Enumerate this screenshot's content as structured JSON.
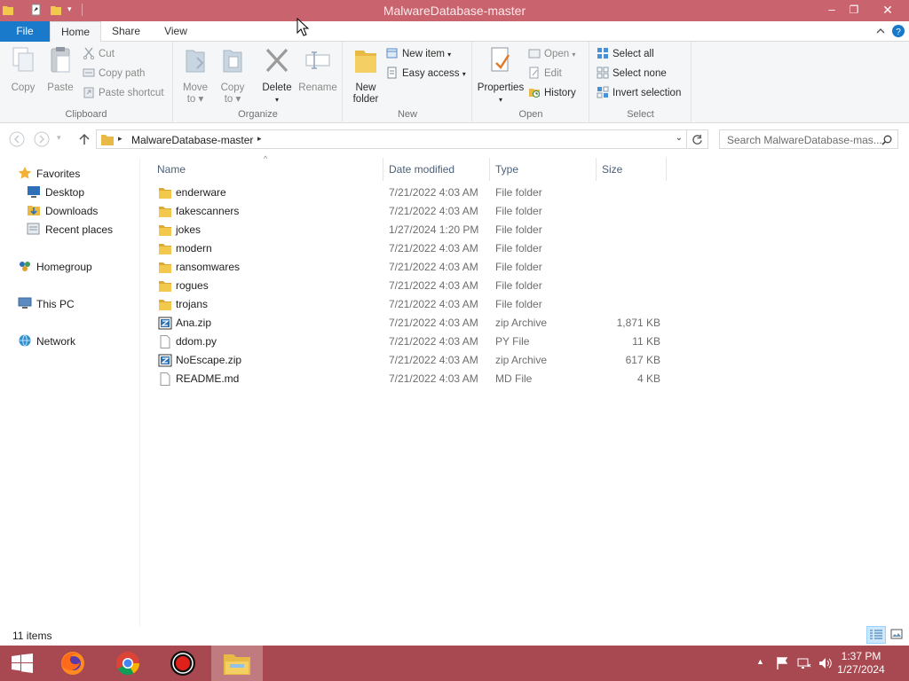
{
  "window": {
    "title": "MalwareDatabase-master"
  },
  "ribbon_tabs": [
    "File",
    "Home",
    "Share",
    "View"
  ],
  "ribbon": {
    "clipboard": {
      "label": "Clipboard",
      "copy": "Copy",
      "paste": "Paste",
      "cut": "Cut",
      "copy_path": "Copy path",
      "paste_shortcut": "Paste shortcut"
    },
    "organize": {
      "label": "Organize",
      "move_to": "Move to",
      "copy_to": "Copy to",
      "delete": "Delete",
      "rename": "Rename"
    },
    "new": {
      "label": "New",
      "new_folder": "New folder",
      "new_item": "New item",
      "easy_access": "Easy access"
    },
    "open": {
      "label": "Open",
      "properties": "Properties",
      "open": "Open",
      "edit": "Edit",
      "history": "History"
    },
    "select": {
      "label": "Select",
      "select_all": "Select all",
      "select_none": "Select none",
      "invert_selection": "Invert selection"
    }
  },
  "address": {
    "path": "MalwareDatabase-master",
    "search_placeholder": "Search MalwareDatabase-mas..."
  },
  "nav_pane": {
    "favorites": "Favorites",
    "desktop": "Desktop",
    "downloads": "Downloads",
    "recent_places": "Recent places",
    "homegroup": "Homegroup",
    "this_pc": "This PC",
    "network": "Network"
  },
  "columns": {
    "name": "Name",
    "date": "Date modified",
    "type": "Type",
    "size": "Size"
  },
  "files": [
    {
      "name": "enderware",
      "date": "7/21/2022 4:03 AM",
      "type": "File folder",
      "size": "",
      "kind": "folder"
    },
    {
      "name": "fakescanners",
      "date": "7/21/2022 4:03 AM",
      "type": "File folder",
      "size": "",
      "kind": "folder"
    },
    {
      "name": "jokes",
      "date": "1/27/2024 1:20 PM",
      "type": "File folder",
      "size": "",
      "kind": "folder"
    },
    {
      "name": "modern",
      "date": "7/21/2022 4:03 AM",
      "type": "File folder",
      "size": "",
      "kind": "folder"
    },
    {
      "name": "ransomwares",
      "date": "7/21/2022 4:03 AM",
      "type": "File folder",
      "size": "",
      "kind": "folder"
    },
    {
      "name": "rogues",
      "date": "7/21/2022 4:03 AM",
      "type": "File folder",
      "size": "",
      "kind": "folder"
    },
    {
      "name": "trojans",
      "date": "7/21/2022 4:03 AM",
      "type": "File folder",
      "size": "",
      "kind": "folder"
    },
    {
      "name": "Ana.zip",
      "date": "7/21/2022 4:03 AM",
      "type": "zip Archive",
      "size": "1,871 KB",
      "kind": "zip"
    },
    {
      "name": "ddom.py",
      "date": "7/21/2022 4:03 AM",
      "type": "PY File",
      "size": "11 KB",
      "kind": "file"
    },
    {
      "name": "NoEscape.zip",
      "date": "7/21/2022 4:03 AM",
      "type": "zip Archive",
      "size": "617 KB",
      "kind": "zip"
    },
    {
      "name": "README.md",
      "date": "7/21/2022 4:03 AM",
      "type": "MD File",
      "size": "4 KB",
      "kind": "file"
    }
  ],
  "status": {
    "item_count": "11 items"
  },
  "taskbar": {
    "time": "1:37 PM",
    "date": "1/27/2024",
    "apps": [
      "firefox-icon",
      "chrome-icon",
      "record-icon",
      "file-explorer-icon"
    ]
  },
  "colors": {
    "titlebar": "#c9636e",
    "taskbar": "#a84850",
    "file_tab": "#1979ca",
    "folder": "#e8b945"
  }
}
